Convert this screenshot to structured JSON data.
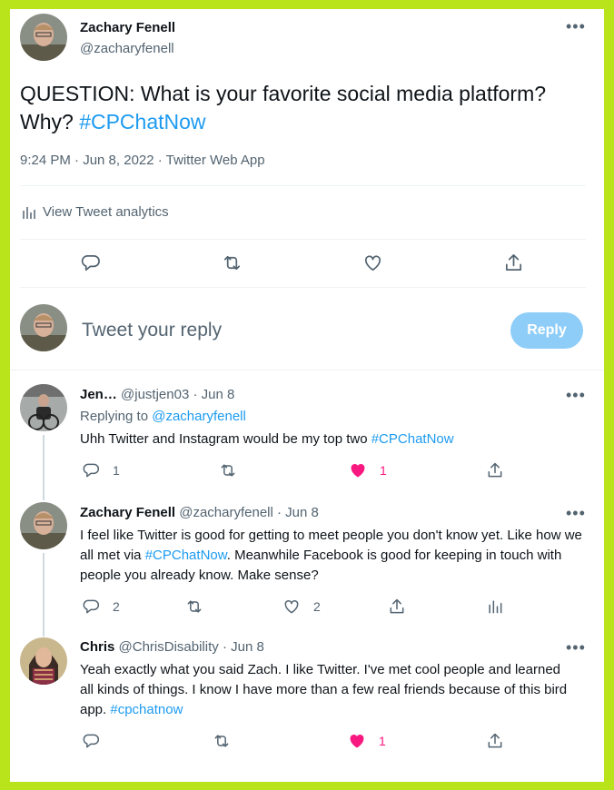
{
  "main_tweet": {
    "display_name": "Zachary Fenell",
    "handle": "@zacharyfenell",
    "text_before": "QUESTION: What is your favorite social media platform? Why? ",
    "hashtag": "#CPChatNow",
    "meta": "9:24 PM · Jun 8, 2022 · Twitter Web App",
    "analytics_label": "View Tweet analytics"
  },
  "reply_box": {
    "placeholder": "Tweet your reply",
    "button_label": "Reply"
  },
  "replies": [
    {
      "display_name": "Jen…",
      "handle": "@justjen03",
      "date": "· Jun 8",
      "replying_prefix": "Replying to ",
      "replying_to": "@zacharyfenell",
      "text_before": "Uhh Twitter and Instagram would be my top two ",
      "hashtag": "#CPChatNow",
      "text_after": "",
      "reply_count": "1",
      "like_count": "1"
    },
    {
      "display_name": "Zachary Fenell",
      "handle": "@zacharyfenell",
      "date": "· Jun 8",
      "text_before": "I feel like Twitter is good for getting to meet people you don't know yet. Like how we all met via ",
      "hashtag": "#CPChatNow",
      "text_after": ". Meanwhile Facebook is good for keeping in touch with people you already know. Make sense?",
      "reply_count": "2",
      "like_count": "2"
    },
    {
      "display_name": "Chris",
      "handle": "@ChrisDisability",
      "date": "· Jun 8",
      "text_before": "Yeah exactly what you said Zach. I like Twitter. I've met cool people and learned all kinds of things. I know I have more than a few real friends because of this bird app. ",
      "hashtag": "#cpchatnow",
      "text_after": "",
      "like_count": "1"
    }
  ],
  "colors": {
    "frame": "#b9e31a",
    "link": "#1d9bf0",
    "like_active": "#f91880",
    "reply_button": "#8ecdf8"
  }
}
